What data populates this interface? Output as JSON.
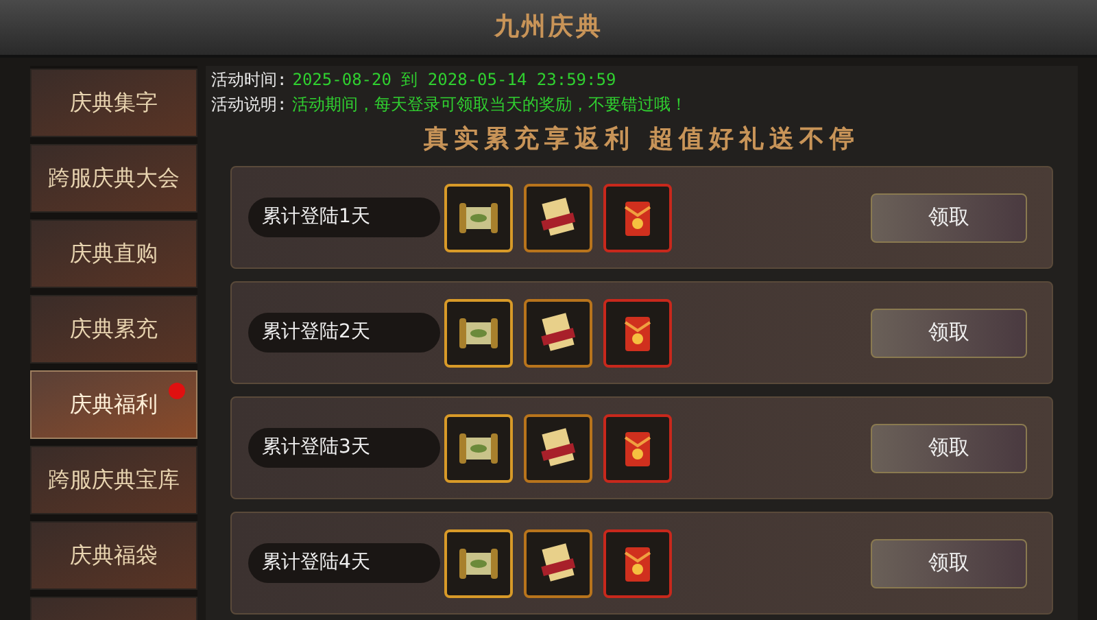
{
  "window": {
    "title": "九州庆典"
  },
  "sidebar": {
    "items": [
      {
        "label": "庆典集字",
        "selected": false,
        "notification": false
      },
      {
        "label": "跨服庆典大会",
        "selected": false,
        "notification": false
      },
      {
        "label": "庆典直购",
        "selected": false,
        "notification": false
      },
      {
        "label": "庆典累充",
        "selected": false,
        "notification": false
      },
      {
        "label": "庆典福利",
        "selected": true,
        "notification": true
      },
      {
        "label": "跨服庆典宝库",
        "selected": false,
        "notification": false
      },
      {
        "label": "庆典福袋",
        "selected": false,
        "notification": false
      },
      {
        "selected": false,
        "notification": false
      }
    ]
  },
  "info": [
    {
      "label": "活动时间:",
      "value": "2025-08-20 到 2028-05-14 23:59:59"
    },
    {
      "label": "活动说明:",
      "value": "活动期间，每天登录可领取当天的奖励，不要错过哦！"
    }
  ],
  "banner": "真实累充享返利 超值好礼送不停",
  "rewards": [
    {
      "label": "累计登陆1天",
      "button": "领取",
      "items": [
        {
          "kind": "scroll",
          "color": "#d89a28"
        },
        {
          "kind": "ticket",
          "color": "#b8741c"
        },
        {
          "kind": "envelope",
          "color": "#c8281c"
        }
      ]
    },
    {
      "label": "累计登陆2天",
      "button": "领取",
      "items": [
        {
          "kind": "scroll",
          "color": "#d89a28"
        },
        {
          "kind": "ticket",
          "color": "#b8741c"
        },
        {
          "kind": "envelope",
          "color": "#c8281c"
        }
      ]
    },
    {
      "label": "累计登陆3天",
      "button": "领取",
      "items": [
        {
          "kind": "scroll",
          "color": "#d89a28"
        },
        {
          "kind": "ticket",
          "color": "#b8741c"
        },
        {
          "kind": "envelope",
          "color": "#c8281c"
        }
      ]
    },
    {
      "label": "累计登陆4天",
      "button": "领取",
      "items": [
        {
          "kind": "scroll",
          "color": "#d89a28"
        },
        {
          "kind": "ticket",
          "color": "#b8741c"
        },
        {
          "kind": "envelope",
          "color": "#c8281c"
        }
      ]
    }
  ]
}
